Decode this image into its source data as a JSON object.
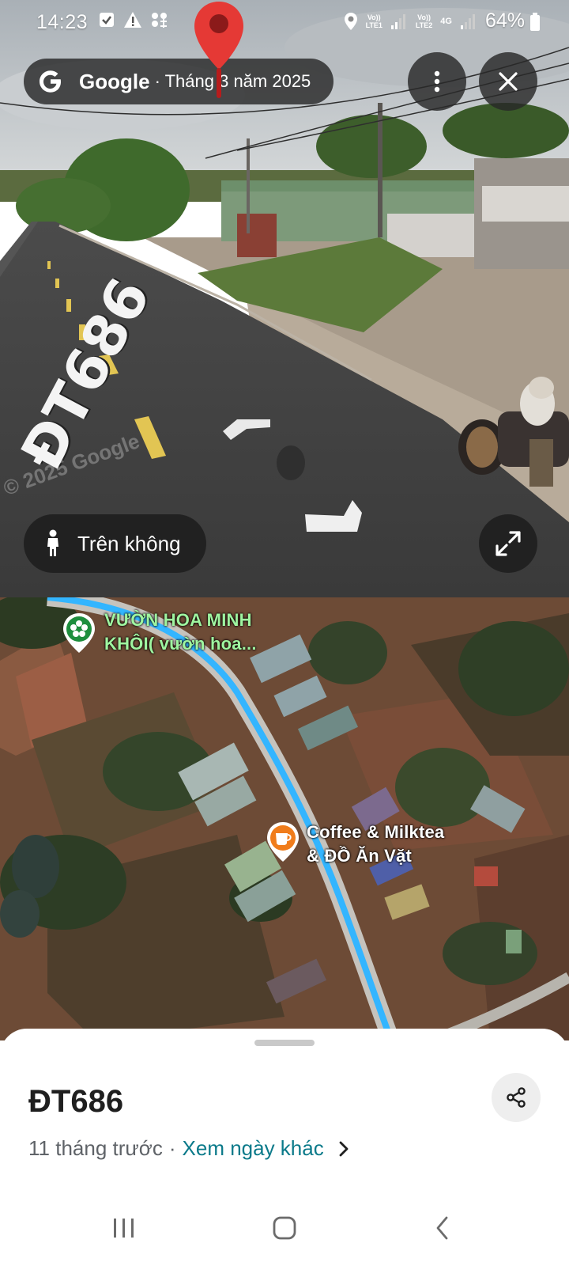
{
  "status_bar": {
    "time": "14:23",
    "battery": "64%",
    "sim1_label": "Vo))\nLTE1",
    "sim2_label": "Vo))\nLTE2",
    "network": "4G"
  },
  "street_view": {
    "brand": "Google",
    "date": "· Tháng 3 năm 2025",
    "road_marking": "ĐT686",
    "watermark": "© 2025 Google",
    "aerial_label": "Trên không",
    "icons": {
      "logo": "google-g-icon",
      "more": "more-vert-icon",
      "close": "close-icon",
      "expand": "expand-icon",
      "pin": "location-pin-icon",
      "person": "pegman-icon"
    }
  },
  "map": {
    "pois": [
      {
        "name_line1": "VƯỜN HOA MINH",
        "name_line2": "KHÔI( vườn hoa...",
        "icon": "flower-icon",
        "color": "#1e8e3e"
      },
      {
        "name_line1": "Coffee & Milktea",
        "name_line2": "& ĐỒ Ăn Vặt",
        "icon": "coffee-cup-icon",
        "color": "#f07c1b"
      }
    ],
    "route_color": "#33b5ff"
  },
  "sheet": {
    "title": "ĐT686",
    "ago": "11 tháng trước",
    "separator": "·",
    "other_dates": "Xem ngày khác",
    "share_icon": "share-icon"
  },
  "nav_bar": {
    "recent_icon": "recent-apps-icon",
    "home_icon": "home-icon",
    "back_icon": "back-icon"
  }
}
